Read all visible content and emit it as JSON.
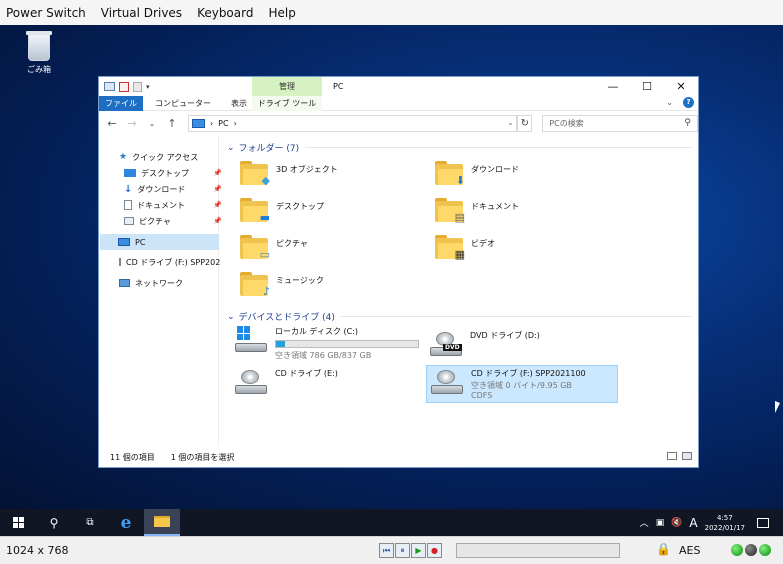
{
  "menubar": {
    "items": [
      "Power Switch",
      "Virtual Drives",
      "Keyboard",
      "Help"
    ]
  },
  "desktop": {
    "recycle_bin_label": "ごみ箱"
  },
  "explorer": {
    "title": "PC",
    "manage_tab": "管理",
    "window_controls": {
      "minimize": "—",
      "maximize": "☐",
      "close": "✕"
    },
    "ribbon": {
      "file": "ファイル",
      "tabs": [
        "コンピューター",
        "表示"
      ],
      "drive_tools": "ドライブ ツール",
      "help": "?"
    },
    "address": {
      "path": [
        "PC"
      ],
      "separator": "›"
    },
    "search": {
      "placeholder": "PCの検索"
    },
    "nav": {
      "quick_access": "クイック アクセス",
      "quick_items": [
        "デスクトップ",
        "ダウンロード",
        "ドキュメント",
        "ピクチャ"
      ],
      "pc": "PC",
      "cd_drive": "CD ドライブ (F:) SPP202",
      "network": "ネットワーク"
    },
    "folders_header": "フォルダー (7)",
    "folders": [
      "3D オブジェクト",
      "ダウンロード",
      "デスクトップ",
      "ドキュメント",
      "ピクチャ",
      "ビデオ",
      "ミュージック"
    ],
    "drives_header": "デバイスとドライブ (4)",
    "drives": {
      "local": {
        "name": "ローカル ディスク (C:)",
        "space": "空き領域 786 GB/837 GB",
        "used_fraction": 0.061
      },
      "dvd": {
        "name": "DVD ドライブ (D:)",
        "badge": "DVD"
      },
      "cd_e": {
        "name": "CD ドライブ (E:)"
      },
      "cd_f": {
        "name": "CD ドライブ (F:) SPP2021100",
        "space": "空き領域 0 バイト/9.95 GB",
        "fs": "CDFS"
      }
    },
    "status": {
      "count": "11 個の項目",
      "selected": "1 個の項目を選択"
    }
  },
  "taskbar": {
    "tray_ime": "A",
    "clock_time": "4:57",
    "clock_date": "2022/01/17"
  },
  "bottombar": {
    "resolution": "1024 x 768",
    "encryption": "AES"
  }
}
